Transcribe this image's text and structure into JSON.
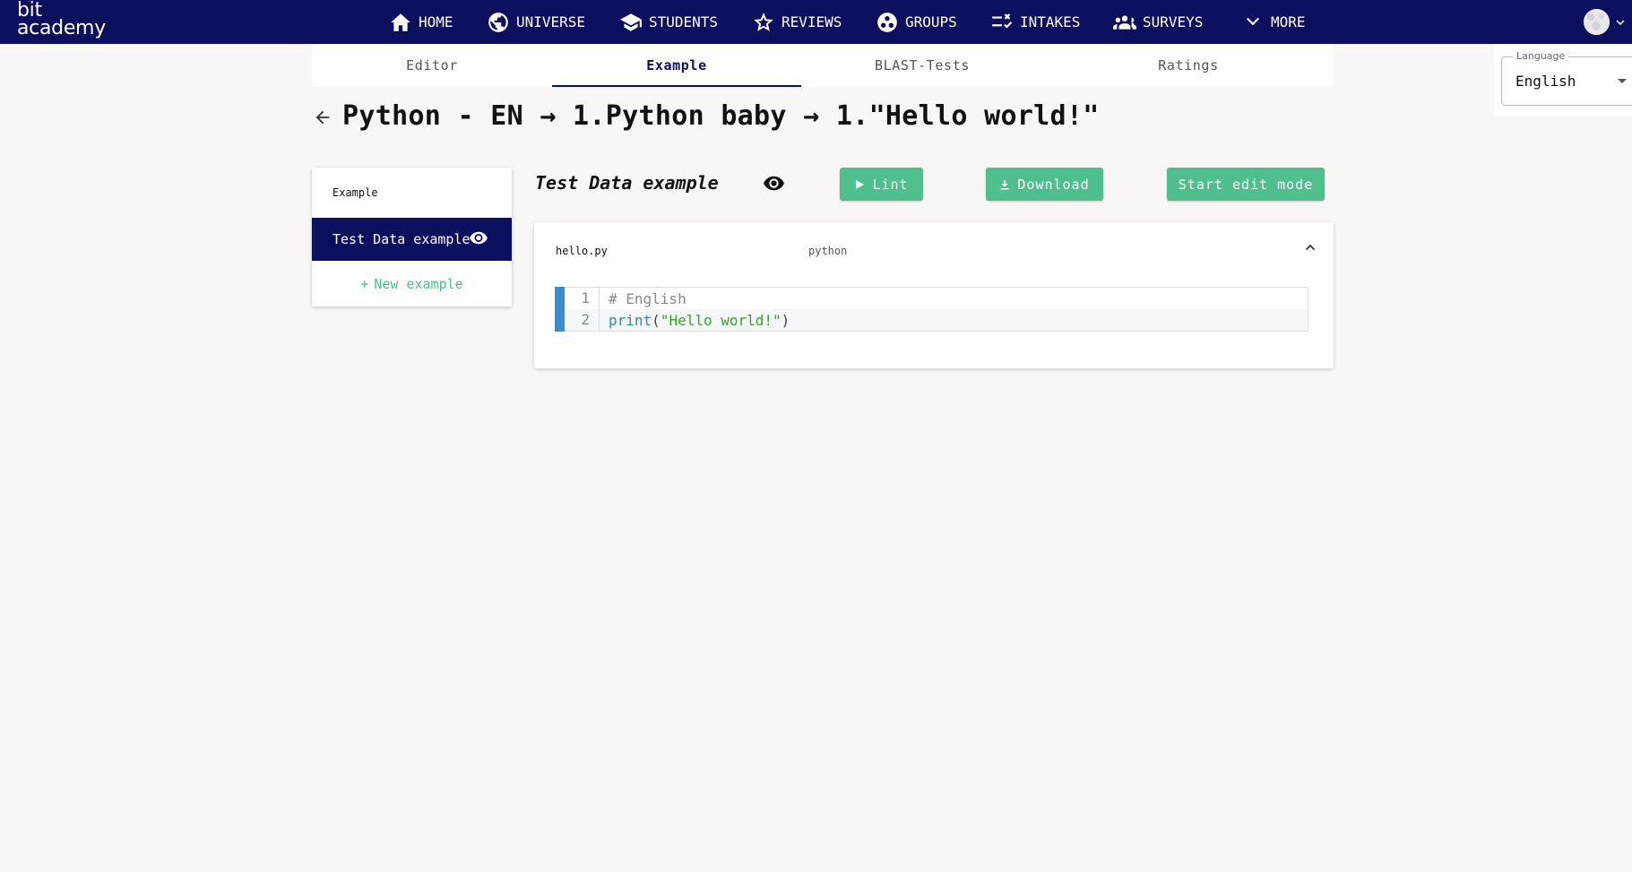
{
  "brand": {
    "line1": "bit",
    "line2": "academy"
  },
  "nav": {
    "home": "HOME",
    "universe": "UNIVERSE",
    "students": "STUDENTS",
    "reviews": "REVIEWS",
    "groups": "GROUPS",
    "intakes": "INTAKES",
    "surveys": "SURVEYS",
    "more": "MORE"
  },
  "language": {
    "legend": "Language",
    "value": "English"
  },
  "tabs": {
    "editor": "Editor",
    "example": "Example",
    "blast_tests": "BLAST-Tests",
    "ratings": "Ratings",
    "active": "Example"
  },
  "breadcrumb": {
    "title": "Python - EN → 1.Python baby → 1.\"Hello world!\""
  },
  "examples": {
    "header": "Example",
    "selected": "Test Data example",
    "new_label": "New example",
    "new_prefix": "+"
  },
  "panel": {
    "title": "Test Data example",
    "lint_label": "Lint",
    "download_label": "Download",
    "edit_label": "Start edit mode"
  },
  "file": {
    "name": "hello.py",
    "language": "python",
    "lines": [
      {
        "number": "1",
        "comment": "# English"
      },
      {
        "number": "2",
        "fn": "print",
        "open": "(",
        "string": "\"Hello world!\"",
        "close": ")"
      }
    ]
  },
  "colors": {
    "navy": "#0b0f5e",
    "green": "#4fbf8e",
    "background": "#f8f7f6",
    "gutter": "#3a8bd1"
  }
}
